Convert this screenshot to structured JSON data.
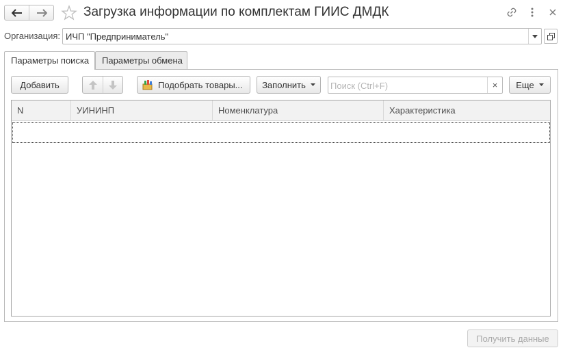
{
  "window": {
    "title": "Загрузка информации по комплектам ГИИС ДМДК"
  },
  "icons": {
    "back": "arrow-left-icon",
    "forward": "arrow-right-icon",
    "favorite": "star-icon",
    "link": "link-icon",
    "more": "more-vertical-icon",
    "close": "close-icon"
  },
  "organization": {
    "label": "Организация:",
    "value": "ИЧП \"Предприниматель\""
  },
  "tabs": [
    {
      "label": "Параметры поиска",
      "active": true
    },
    {
      "label": "Параметры обмена",
      "active": false
    }
  ],
  "toolbar": {
    "add_label": "Добавить",
    "pick_goods_label": "Подобрать товары...",
    "fill_label": "Заполнить",
    "more_label": "Еще"
  },
  "search": {
    "placeholder": "Поиск (Ctrl+F)",
    "clear_glyph": "×"
  },
  "table": {
    "columns": [
      "N",
      "УИНИНП",
      "Номенклатура",
      "Характеристика"
    ],
    "rows": []
  },
  "footer": {
    "get_data_label": "Получить данные"
  },
  "colors": {
    "border": "#b9b9b9",
    "header_bg": "#f2f2f2",
    "inactive_tab_bg": "#ececec",
    "disabled_text": "#a8a8a8"
  }
}
